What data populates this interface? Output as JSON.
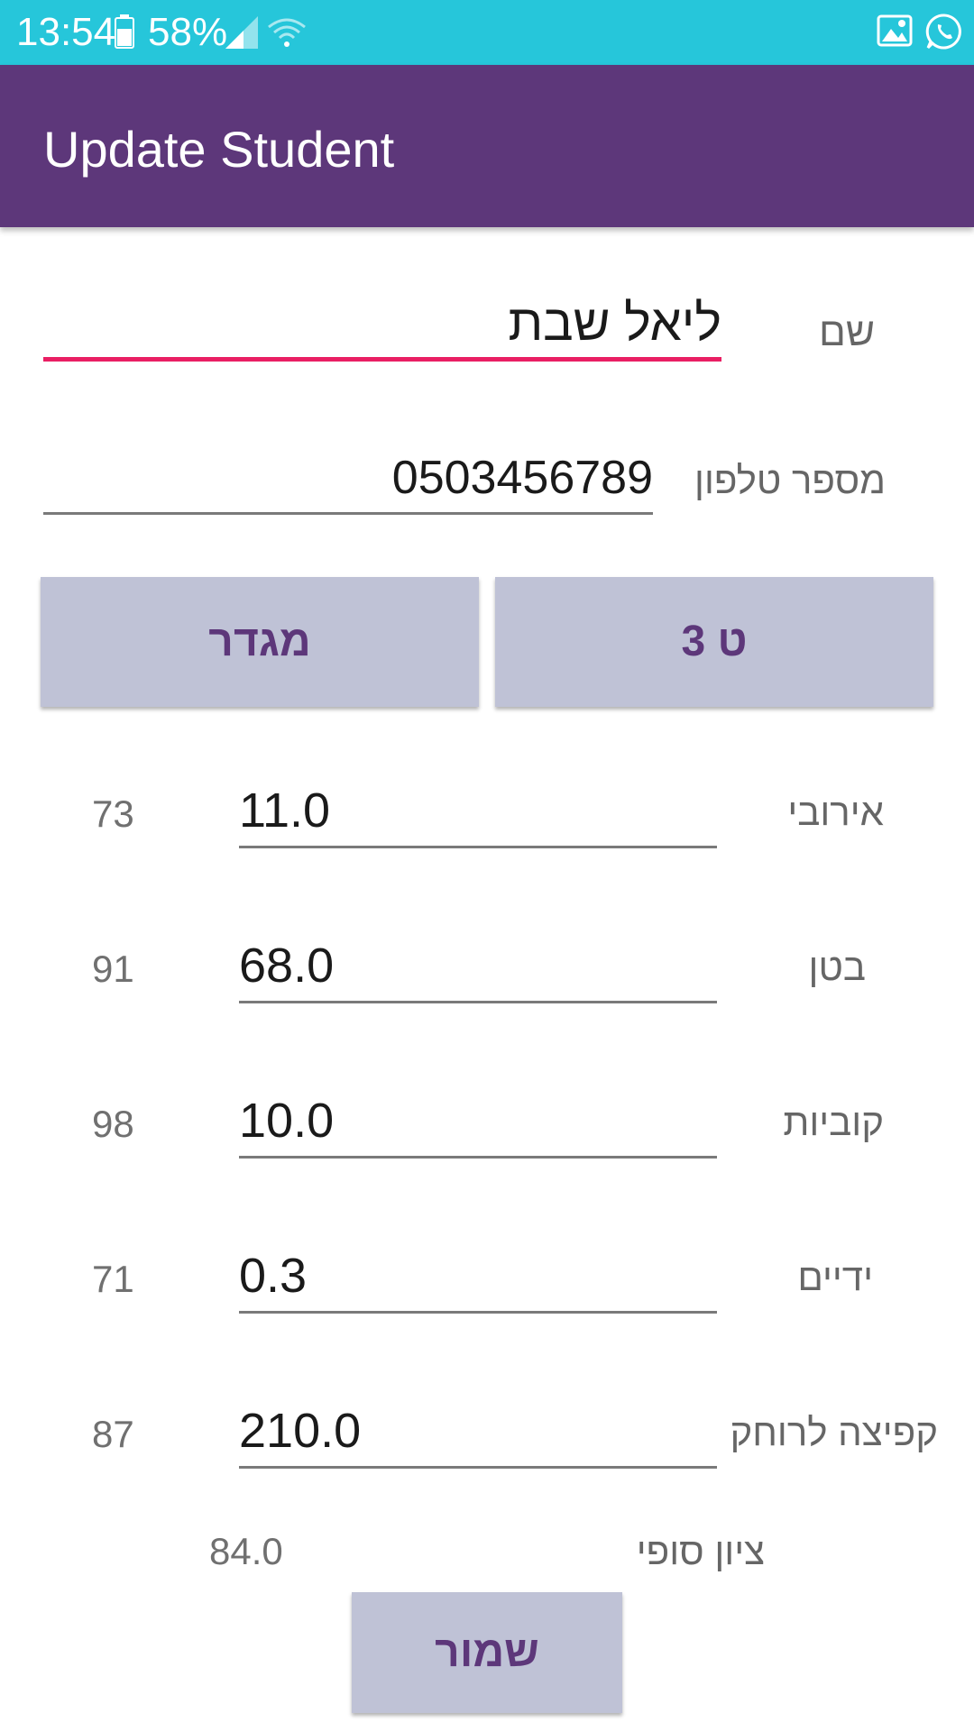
{
  "status_bar": {
    "time": "13:54",
    "battery": "58%",
    "icons": [
      "battery-icon",
      "signal-icon",
      "wifi-icon",
      "gallery-icon",
      "whatsapp-icon"
    ]
  },
  "app_bar": {
    "title": "Update Student"
  },
  "form": {
    "name_label": "שם",
    "name_value": "ליאל שבת",
    "phone_label": "מספר טלפון",
    "phone_value": "0503456789",
    "class_button": "ט 3",
    "gender_button": "מגדר",
    "rows": [
      {
        "label": "אירובי",
        "value": "11.0",
        "score": "73"
      },
      {
        "label": "בטן",
        "value": "68.0",
        "score": "91"
      },
      {
        "label": "קוביות",
        "value": "10.0",
        "score": "98"
      },
      {
        "label": "ידיים",
        "value": "0.3",
        "score": "71"
      },
      {
        "label": "קפיצה לרוחק",
        "value": "210.0",
        "score": "87"
      }
    ],
    "final_label": "ציון סופי",
    "final_value": "84.0",
    "save_button": "שמור"
  },
  "colors": {
    "status_bar": "#26c6da",
    "app_bar": "#5d377a",
    "accent": "#e91e63",
    "button_bg": "#bfc2d6"
  }
}
